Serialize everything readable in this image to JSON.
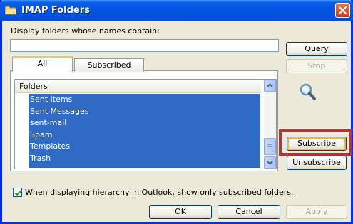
{
  "window": {
    "title": "IMAP Folders"
  },
  "filter": {
    "label": "Display folders whose names contain:",
    "value": ""
  },
  "buttons": {
    "query": "Query",
    "stop": "Stop",
    "subscribe": "Subscribe",
    "unsubscribe": "Unsubscribe",
    "ok": "OK",
    "cancel": "Cancel",
    "apply": "Apply"
  },
  "tabs": [
    {
      "label": "All",
      "active": true
    },
    {
      "label": "Subscribed",
      "active": false
    }
  ],
  "list": {
    "header": "Folders",
    "items": [
      "Sent Items",
      "Sent Messages",
      "sent-mail",
      "Spam",
      "Templates",
      "Trash"
    ],
    "selected": [
      "Sent Items",
      "Sent Messages",
      "sent-mail",
      "Spam",
      "Templates",
      "Trash"
    ]
  },
  "checkbox": {
    "label": "When displaying hierarchy in Outlook, show only subscribed folders.",
    "checked": true
  },
  "colors": {
    "selection": "#316ac5",
    "highlight": "#a8383f",
    "titlebar": "#0454e3"
  },
  "icons": [
    "folder-icon",
    "close-icon",
    "magnifier-icon",
    "checkmark-icon",
    "scroll-up-icon",
    "scroll-down-icon"
  ]
}
